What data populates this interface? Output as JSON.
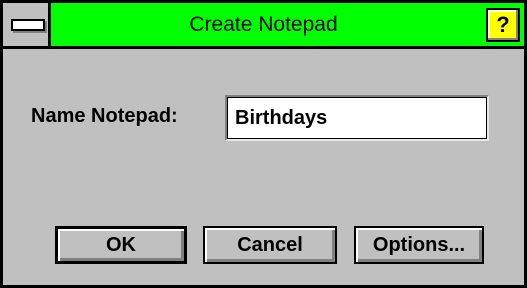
{
  "window": {
    "title": "Create Notepad",
    "help_symbol": "?",
    "colors": {
      "titlebar": "#00ff00",
      "help": "#ffff00",
      "face": "#c0c0c0"
    }
  },
  "form": {
    "name_label": "Name Notepad:",
    "name_value": "Birthdays"
  },
  "buttons": {
    "ok": "OK",
    "cancel": "Cancel",
    "options": "Options..."
  },
  "icons": {
    "system_menu": "system-menu-icon",
    "help": "help-icon"
  }
}
